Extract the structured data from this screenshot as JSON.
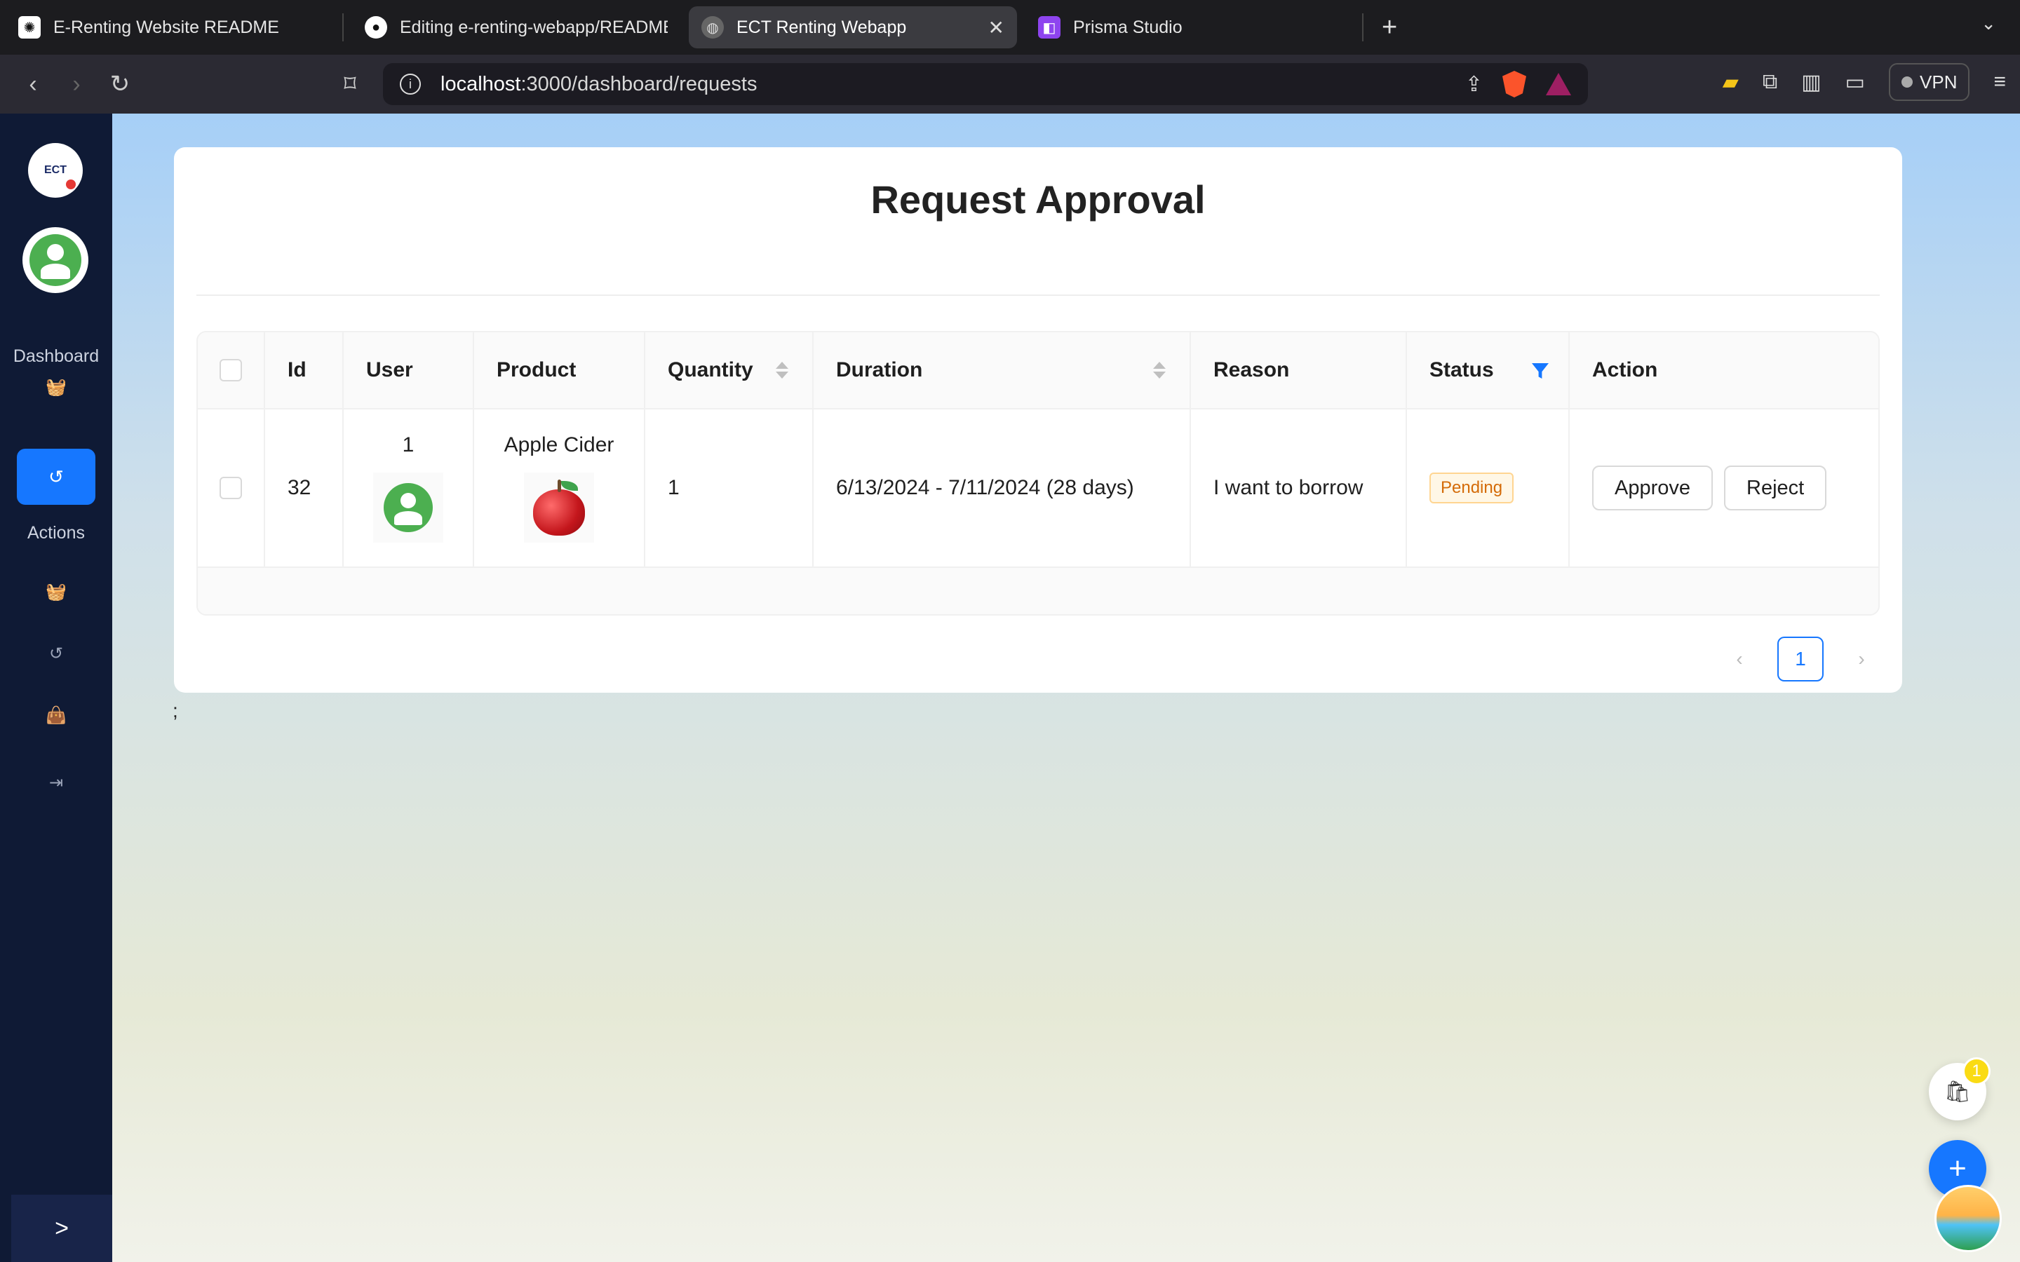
{
  "browser": {
    "tabs": [
      {
        "title": "E-Renting Website README",
        "icon": "openai-icon",
        "active": false
      },
      {
        "title": "Editing e-renting-webapp/README.md",
        "icon": "github-icon",
        "active": false
      },
      {
        "title": "ECT Renting Webapp",
        "icon": "globe-icon",
        "active": true
      },
      {
        "title": "Prisma Studio",
        "icon": "prisma-icon",
        "active": false
      }
    ],
    "url_host": "localhost",
    "url_path": ":3000/dashboard/requests",
    "vpn_label": "VPN"
  },
  "sidebar": {
    "logo_text": "ECT",
    "dashboard_label": "Dashboard",
    "actions_label": "Actions",
    "collapse_symbol": ">"
  },
  "page": {
    "title": "Request Approval",
    "trailing_text": ";"
  },
  "table": {
    "columns": [
      "Id",
      "User",
      "Product",
      "Quantity",
      "Duration",
      "Reason",
      "Status",
      "Action"
    ],
    "rows": [
      {
        "id": "32",
        "user": "1",
        "product": "Apple Cider",
        "quantity": "1",
        "duration": "6/13/2024 - 7/11/2024 (28 days)",
        "reason": "I want to borrow",
        "status": "Pending",
        "approve_label": "Approve",
        "reject_label": "Reject"
      }
    ]
  },
  "pagination": {
    "current": "1"
  },
  "cart": {
    "count": "1"
  },
  "colors": {
    "primary": "#1677ff",
    "sidebar": "#0f1a35",
    "pending": "#d46b08"
  }
}
